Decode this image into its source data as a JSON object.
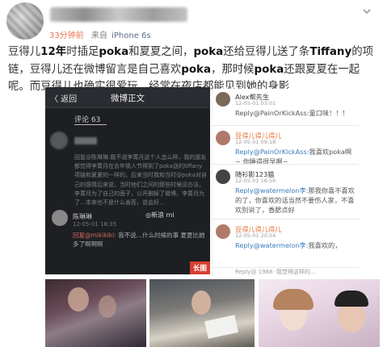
{
  "post": {
    "time": "33分钟前",
    "source_prefix": "来自",
    "device": "iPhone 6s",
    "text_segments": [
      {
        "t": "豆得儿"
      },
      {
        "t": "12年",
        "b": true
      },
      {
        "t": "时插足"
      },
      {
        "t": "poka",
        "b": true
      },
      {
        "t": "和夏夏之间，"
      },
      {
        "t": "poka",
        "b": true
      },
      {
        "t": "还给豆得儿送了条"
      },
      {
        "t": "Tiffany",
        "b": true
      },
      {
        "t": "的项链，豆得儿还在微博留言是自己喜欢"
      },
      {
        "t": "poka",
        "b": true
      },
      {
        "t": "，那时候"
      },
      {
        "t": "poka",
        "b": true
      },
      {
        "t": "还跟夏夏在一起呢。而豆得儿也确实很爱玩，经常在夜店都能见到她的身影"
      }
    ]
  },
  "left_screenshot": {
    "back_label": "〈 返回",
    "title": "微博正文",
    "comments_label": "评论 63",
    "blurred_para": "回复@陈琳琳:我不说李菁月这个人怎么样，我的朋友都觉得李菁月在去年情人节得到了poka送的tiffany项链和夏夏的一样的，后来当时我和当时@poka对自己的感情后来说，当时他们之间的那些时候没办法，李菁月为了自己的面子，公开删掉了微博，李菁月为了…本来也不是什么善茬，说会好…",
    "commenter": "陈琳琳",
    "commenter_date": "12-05-01 18:35",
    "reply_prefix": "回复@mikikiki: ",
    "reply_text": "我不说…什么时候的事 夏夏比她多了啊啊啊",
    "watermark": "◎新浪 mi",
    "tag": "长图"
  },
  "right_screenshot": {
    "comments": [
      {
        "name": "Alex帮先生",
        "name_color": "dark",
        "date": "12-05-01 03:01",
        "text": "Reply@PainOrKickAss:童口味！！！",
        "avatar": "#7a6a5a"
      },
      {
        "name": "豆得儿得儿得儿",
        "name_color": "orange",
        "date": "12-05-01 09:18",
        "text_link": "Reply@PainOrKickAss:",
        "text": "我喜欢poka啊~ 你睡得很早啊~",
        "avatar": "#b07a6a"
      },
      {
        "name": "随衫影123猫",
        "name_color": "dark",
        "date": "12-05-01 16:56",
        "text_link": "Reply@watermelon李:",
        "text": "那我你喜不喜欢的了，你喜欢的话当然不要伤人家，不喜欢别说了，香腮点好",
        "avatar": "#444"
      },
      {
        "name": "豆得儿得儿得儿",
        "name_color": "orange",
        "date": "12-05-01 20:54",
        "text_link": "Reply@watermelon李:",
        "text": "我喜欢的，",
        "avatar": "#b07a6a"
      }
    ],
    "footer": "Reply@ 1988 ·我觉得这样的…"
  },
  "colors": {
    "time": "#eb7350",
    "device": "#596a8a",
    "tag": "#d93f2f",
    "link": "#3a7bbf",
    "orange_name": "#e3733a"
  }
}
